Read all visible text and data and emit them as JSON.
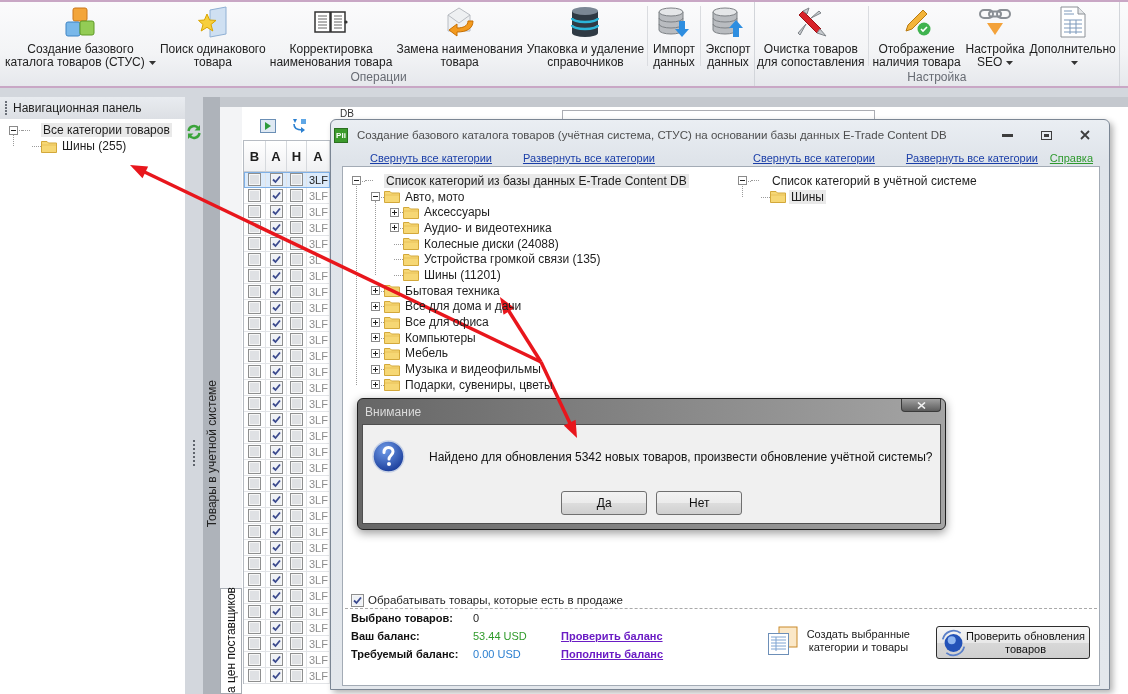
{
  "ribbon": {
    "groups": [
      {
        "label": "Операции",
        "sections": [
          {
            "buttons": [
              {
                "lines": [
                  "Создание базового",
                  "каталога товаров (СТУС)"
                ],
                "dropdown": true
              },
              {
                "lines": [
                  "Поиск одинакового",
                  "товара"
                ],
                "dropdown": false
              },
              {
                "lines": [
                  "Корректировка",
                  "наименования товара"
                ],
                "dropdown": false
              },
              {
                "lines": [
                  "Замена наименования",
                  "товара"
                ],
                "dropdown": false
              },
              {
                "lines": [
                  "Упаковка и удаление",
                  "справочников"
                ],
                "dropdown": false
              }
            ]
          },
          {
            "buttons": [
              {
                "lines": [
                  "Импорт",
                  "данных"
                ],
                "dropdown": false
              }
            ]
          },
          {
            "buttons": [
              {
                "lines": [
                  "Экспорт",
                  "данных"
                ],
                "dropdown": false
              }
            ]
          }
        ]
      },
      {
        "label": "Настройка",
        "sections": [
          {
            "buttons": [
              {
                "lines": [
                  "Очистка товаров",
                  "для сопоставления"
                ],
                "dropdown": false
              }
            ]
          },
          {
            "buttons": [
              {
                "lines": [
                  "Отображение",
                  "наличия товара"
                ],
                "dropdown": false
              },
              {
                "lines": [
                  "Настройка",
                  "SEO"
                ],
                "dropdown": true
              },
              {
                "lines": [
                  "Дополнительно"
                ],
                "dropdown": true
              }
            ]
          }
        ]
      }
    ]
  },
  "nav_panel": {
    "title": "Навигационная панель",
    "tree": [
      {
        "label": "Все категории товаров",
        "expanded": true,
        "selected": true,
        "children": [
          {
            "label": "Шины (255)",
            "selected": false
          }
        ]
      }
    ]
  },
  "products": {
    "dock_tab": "Товары в учетной системе",
    "toolbar_label": "DB",
    "tabs": [
      {
        "label": "а цен поставщиков",
        "selected": true
      }
    ],
    "grid": {
      "columns": [
        "В",
        "А",
        "Н",
        "А"
      ],
      "rows": [
        {
          "selected": true,
          "checks": [
            false,
            true,
            false
          ],
          "code": "3LF"
        },
        {
          "selected": false,
          "checks": [
            false,
            true,
            false
          ],
          "code": "3LF"
        },
        {
          "selected": false,
          "checks": [
            false,
            true,
            false
          ],
          "code": "3LF"
        },
        {
          "selected": false,
          "checks": [
            false,
            true,
            false
          ],
          "code": "3LF"
        },
        {
          "selected": false,
          "checks": [
            false,
            true,
            false
          ],
          "code": "3LF"
        },
        {
          "selected": false,
          "checks": [
            false,
            true,
            false
          ],
          "code": "3L"
        },
        {
          "selected": false,
          "checks": [
            false,
            true,
            false
          ],
          "code": "3LF"
        },
        {
          "selected": false,
          "checks": [
            false,
            true,
            false
          ],
          "code": "3LF"
        },
        {
          "selected": false,
          "checks": [
            false,
            true,
            false
          ],
          "code": "3LF"
        },
        {
          "selected": false,
          "checks": [
            false,
            true,
            false
          ],
          "code": "3LF"
        },
        {
          "selected": false,
          "checks": [
            false,
            true,
            false
          ],
          "code": "3LF"
        },
        {
          "selected": false,
          "checks": [
            false,
            true,
            false
          ],
          "code": "3LF"
        },
        {
          "selected": false,
          "checks": [
            false,
            true,
            false
          ],
          "code": "3LF"
        },
        {
          "selected": false,
          "checks": [
            false,
            true,
            false
          ],
          "code": "3LF"
        },
        {
          "selected": false,
          "checks": [
            false,
            true,
            false
          ],
          "code": "3LF"
        },
        {
          "selected": false,
          "checks": [
            false,
            true,
            false
          ],
          "code": "3LF"
        },
        {
          "selected": false,
          "checks": [
            false,
            true,
            false
          ],
          "code": "3LF"
        },
        {
          "selected": false,
          "checks": [
            false,
            true,
            false
          ],
          "code": "3LF"
        },
        {
          "selected": false,
          "checks": [
            false,
            true,
            false
          ],
          "code": "3LF"
        },
        {
          "selected": false,
          "checks": [
            false,
            true,
            false
          ],
          "code": "3LF"
        },
        {
          "selected": false,
          "checks": [
            false,
            true,
            false
          ],
          "code": "3LF"
        },
        {
          "selected": false,
          "checks": [
            false,
            true,
            false
          ],
          "code": "3LF"
        },
        {
          "selected": false,
          "checks": [
            false,
            true,
            false
          ],
          "code": "3LF"
        },
        {
          "selected": false,
          "checks": [
            false,
            true,
            false
          ],
          "code": "3LF"
        },
        {
          "selected": false,
          "checks": [
            false,
            true,
            false
          ],
          "code": "3LF"
        },
        {
          "selected": false,
          "checks": [
            false,
            true,
            false
          ],
          "code": "3LF"
        },
        {
          "selected": false,
          "checks": [
            false,
            true,
            false
          ],
          "code": "3LF"
        },
        {
          "selected": false,
          "checks": [
            false,
            true,
            false
          ],
          "code": "3LF"
        },
        {
          "selected": false,
          "checks": [
            false,
            true,
            false
          ],
          "code": "3LF"
        },
        {
          "selected": false,
          "checks": [
            false,
            true,
            false
          ],
          "code": "3LF"
        },
        {
          "selected": false,
          "checks": [
            false,
            true,
            false
          ],
          "code": "3LF"
        },
        {
          "selected": false,
          "checks": [
            false,
            true,
            false
          ],
          "code": "3LF"
        }
      ]
    }
  },
  "dialog": {
    "logo": "Pli",
    "title": "Создание базового каталога товаров (учётная система, СТУС) на основании базы данных E-Trade Content DB",
    "left_links": [
      "Свернуть все категории",
      "Развернуть все категории"
    ],
    "right_links": [
      "Свернуть все категории",
      "Развернуть все категории"
    ],
    "help_link": "Справка",
    "source_tree": [
      {
        "label": "Список категорий из базы данных E-Trade Content DB",
        "expanded": true,
        "selected": true,
        "children": [
          {
            "label": "Авто, мото",
            "expanded": true,
            "selected": false,
            "children": [
              {
                "label": "Аксессуары",
                "expanded": false,
                "selected": false
              },
              {
                "label": "Аудио- и видеотехника",
                "expanded": false,
                "selected": false
              },
              {
                "label": "Колесные диски (24088)",
                "selected": false
              },
              {
                "label": "Устройства громкой связи (135)",
                "selected": false
              },
              {
                "label": "Шины (11201)",
                "selected": false
              }
            ]
          },
          {
            "label": "Бытовая техника",
            "expanded": false,
            "selected": false
          },
          {
            "label": "Все для дома и дачи",
            "expanded": false,
            "selected": false
          },
          {
            "label": "Все для офиса",
            "expanded": false,
            "selected": false
          },
          {
            "label": "Компьютеры",
            "expanded": false,
            "selected": false
          },
          {
            "label": "Мебель",
            "expanded": false,
            "selected": false
          },
          {
            "label": "Музыка и видеофильмы",
            "expanded": false,
            "selected": false
          },
          {
            "label": "Подарки, сувениры, цветы",
            "expanded": false,
            "selected": false
          }
        ]
      }
    ],
    "target_tree": [
      {
        "label": "Список категорий в учётной системе",
        "expanded": true,
        "selected": false,
        "children": [
          {
            "label": "Шины",
            "selected": true
          }
        ]
      }
    ],
    "in_stock_option": {
      "label": "Обрабатывать товары, которые есть в продаже",
      "checked": true
    },
    "stats": [
      {
        "label": "Выбрано товаров:",
        "value": "0"
      },
      {
        "label": "Ваш баланс:",
        "value": "53.44 USD",
        "color": "#2f9a2a",
        "link": "Проверить баланс"
      },
      {
        "label": "Требуемый баланс:",
        "value": "0.00 USD",
        "color": "#2a7fd0",
        "link": "Пополнить баланс"
      }
    ],
    "create_action": [
      "Создать выбранные",
      "категории и товары"
    ],
    "check_updates_button": [
      "Проверить обновления",
      "товаров"
    ]
  },
  "message_box": {
    "title": "Внимание",
    "text": "Найдено для обновления 5342 новых товаров, произвести обновление учётной системы?",
    "buttons": [
      "Да",
      "Нет"
    ]
  }
}
